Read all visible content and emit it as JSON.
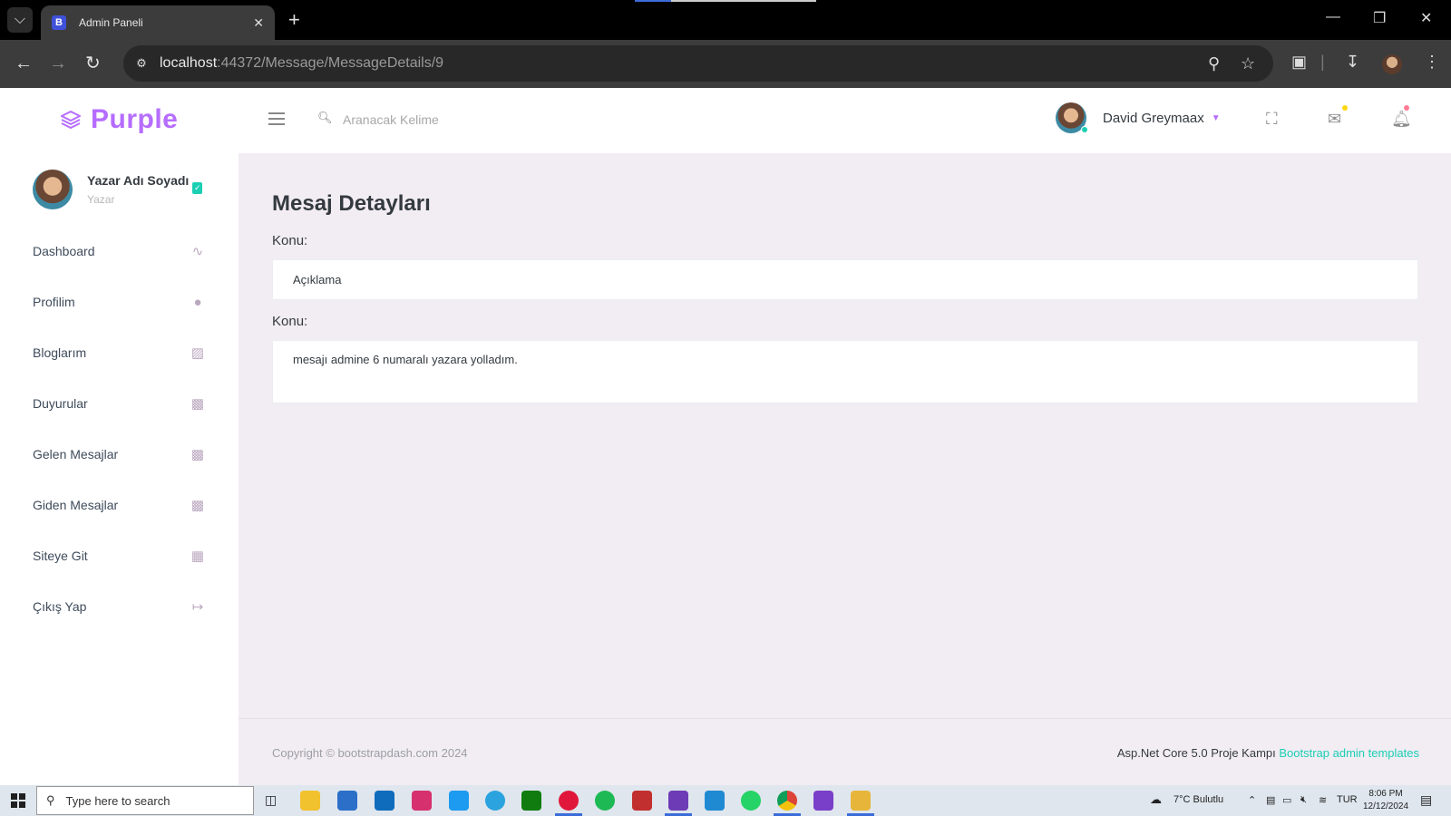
{
  "browser": {
    "tab_title": "Admin Paneli",
    "tab_favicon": "B",
    "url_host": "localhost",
    "url_rest": ":44372/Message/MessageDetails/9"
  },
  "header": {
    "brand": "Purple",
    "search_placeholder": "Aranacak Kelime",
    "profile_name": "David Greymaax"
  },
  "sidebar": {
    "user_name": "Yazar Adı Soyadı",
    "user_role": "Yazar",
    "items": [
      {
        "label": "Dashboard",
        "icon": "chart-line-icon"
      },
      {
        "label": "Profilim",
        "icon": "user-icon"
      },
      {
        "label": "Bloglarım",
        "icon": "blogger-icon"
      },
      {
        "label": "Duyurular",
        "icon": "message-icon"
      },
      {
        "label": "Gelen Mesajlar",
        "icon": "message-icon"
      },
      {
        "label": "Giden Mesajlar",
        "icon": "message-icon"
      },
      {
        "label": "Siteye Git",
        "icon": "grid-icon"
      },
      {
        "label": "Çıkış Yap",
        "icon": "logout-icon"
      }
    ]
  },
  "main": {
    "title": "Mesaj Detayları",
    "fields": [
      {
        "label": "Konu:",
        "value": "Açıklama"
      },
      {
        "label": "Konu:",
        "value": "mesajı admine 6 numaralı yazara yolladım."
      }
    ]
  },
  "footer": {
    "copyright": "Copyright © bootstrapdash.com 2024",
    "right_text": "Asp.Net Core 5.0 Proje Kampı ",
    "right_link": "Bootstrap admin templates"
  },
  "taskbar": {
    "search_placeholder": "Type here to search",
    "weather": "7°C  Bulutlu",
    "language": "TUR",
    "time": "8:06 PM",
    "date": "12/12/2024"
  },
  "colors": {
    "brand": "#b66dff",
    "accent": "#1bcfb4",
    "background": "#f2edf3"
  }
}
